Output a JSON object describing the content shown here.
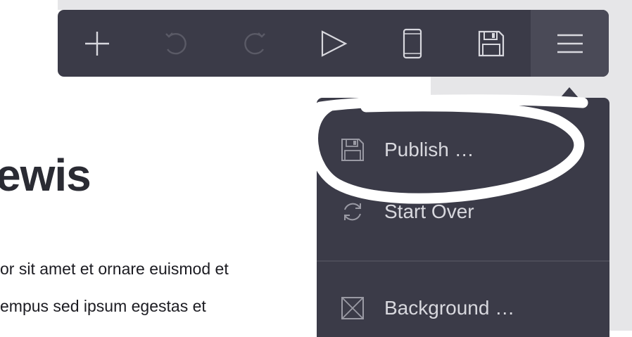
{
  "page": {
    "heading": "ewis",
    "paragraph_lines": [
      "or sit amet et ornare euismod et",
      "empus sed ipsum egestas et"
    ]
  },
  "toolbar": {
    "buttons": [
      {
        "name": "add",
        "icon": "plus-icon",
        "enabled": true
      },
      {
        "name": "undo",
        "icon": "undo-icon",
        "enabled": false
      },
      {
        "name": "redo",
        "icon": "redo-icon",
        "enabled": false
      },
      {
        "name": "preview",
        "icon": "play-icon",
        "enabled": true
      },
      {
        "name": "mobile-view",
        "icon": "phone-icon",
        "enabled": true
      },
      {
        "name": "save",
        "icon": "floppy-disk-icon",
        "enabled": true
      },
      {
        "name": "menu",
        "icon": "hamburger-icon",
        "enabled": true,
        "active": true
      }
    ]
  },
  "menu": {
    "items": [
      {
        "label": "Publish …",
        "icon": "floppy-disk-icon"
      },
      {
        "label": "Start Over",
        "icon": "refresh-icon"
      },
      {
        "label": "Background …",
        "icon": "image-placeholder-icon"
      }
    ]
  },
  "colors": {
    "toolbar_bg": "#3b3b48",
    "toolbar_active_bg": "#4a4a57",
    "icon_enabled": "#d8d8de",
    "icon_disabled": "#5a5a66",
    "menu_text": "#d8d8de",
    "annotation": "#ffffff"
  }
}
